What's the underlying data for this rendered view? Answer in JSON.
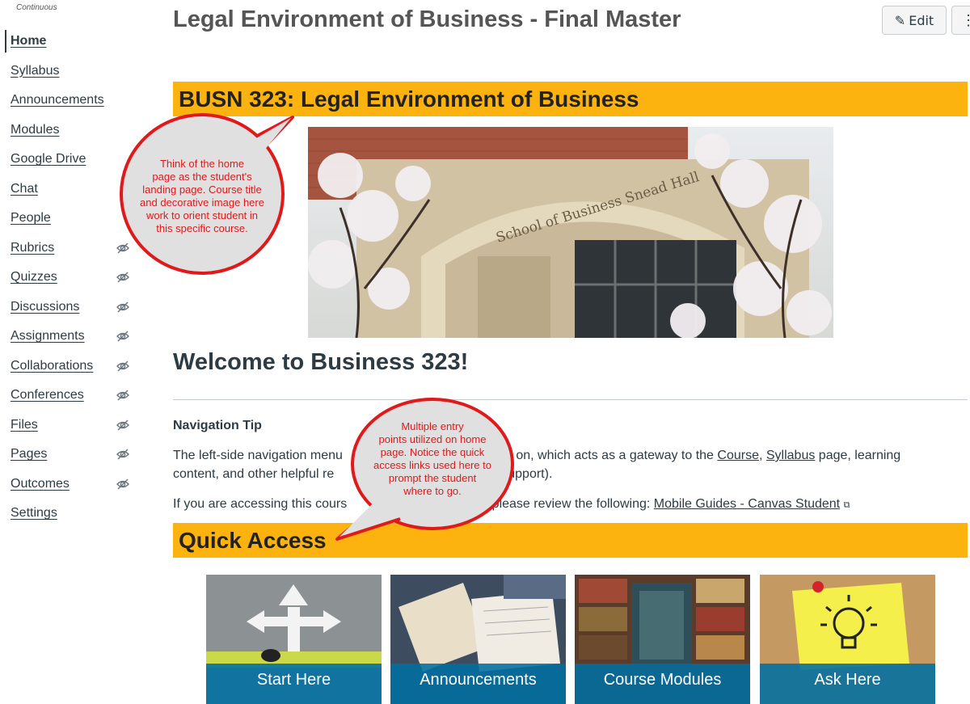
{
  "sidebar": {
    "term_label": "Continuous",
    "items": [
      {
        "label": "Home",
        "active": true,
        "hidden": false
      },
      {
        "label": "Syllabus",
        "hidden": false
      },
      {
        "label": "Announcements",
        "hidden": false
      },
      {
        "label": "Modules",
        "hidden": false
      },
      {
        "label": "Google Drive",
        "hidden": false
      },
      {
        "label": "Chat",
        "hidden": false
      },
      {
        "label": "People",
        "hidden": false
      },
      {
        "label": "Rubrics",
        "hidden": true
      },
      {
        "label": "Quizzes",
        "hidden": true
      },
      {
        "label": "Discussions",
        "hidden": true
      },
      {
        "label": "Assignments",
        "hidden": true
      },
      {
        "label": "Collaborations",
        "hidden": true
      },
      {
        "label": "Conferences",
        "hidden": true
      },
      {
        "label": "Files",
        "hidden": true
      },
      {
        "label": "Pages",
        "hidden": true
      },
      {
        "label": "Outcomes",
        "hidden": true
      },
      {
        "label": "Settings",
        "hidden": false
      }
    ],
    "hidden_icon": "eye-slash-icon"
  },
  "header": {
    "title": "Legal Environment of Business - Final Master",
    "edit_label": "Edit",
    "edit_icon": "pencil-icon",
    "more_label": "⋮"
  },
  "content": {
    "course_banner": "BUSN 323: Legal Environment of Business",
    "hero_sign": "School of Business Snead Hall",
    "welcome": "Welcome to Business 323!",
    "nav_tip_heading": "Navigation Tip",
    "p1_a": "The left-side navigation menu",
    "p1_b": " on, which acts as a gateway to the ",
    "p1_link1": "Course",
    "p1_c": ", ",
    "p1_link2": "Syllabus",
    "p1_d": " page, learning",
    "p1_e": "content, and other helpful re",
    "p1_f": "upport).",
    "p2_a": "If you are accessing this cours",
    "p2_b": " please review the following: ",
    "p2_link": "Mobile Guides - Canvas Student",
    "quick_access": "Quick Access",
    "tiles": [
      {
        "label": "Start Here"
      },
      {
        "label": "Announcements"
      },
      {
        "label": "Course Modules"
      },
      {
        "label": "Ask Here"
      }
    ]
  },
  "callouts": {
    "c1": [
      "Think of the home",
      "page as the student's",
      "landing page. Course title",
      "and decorative image here",
      "work to orient student in",
      "this specific course."
    ],
    "c2": [
      "Multiple entry",
      "points utilized on home",
      "page. Notice the quick",
      "access links used here to",
      "prompt the student",
      "where to go."
    ]
  },
  "colors": {
    "banner": "#fcb30f",
    "callout_border": "#e01a1a",
    "tile_label": "#006ea0"
  }
}
